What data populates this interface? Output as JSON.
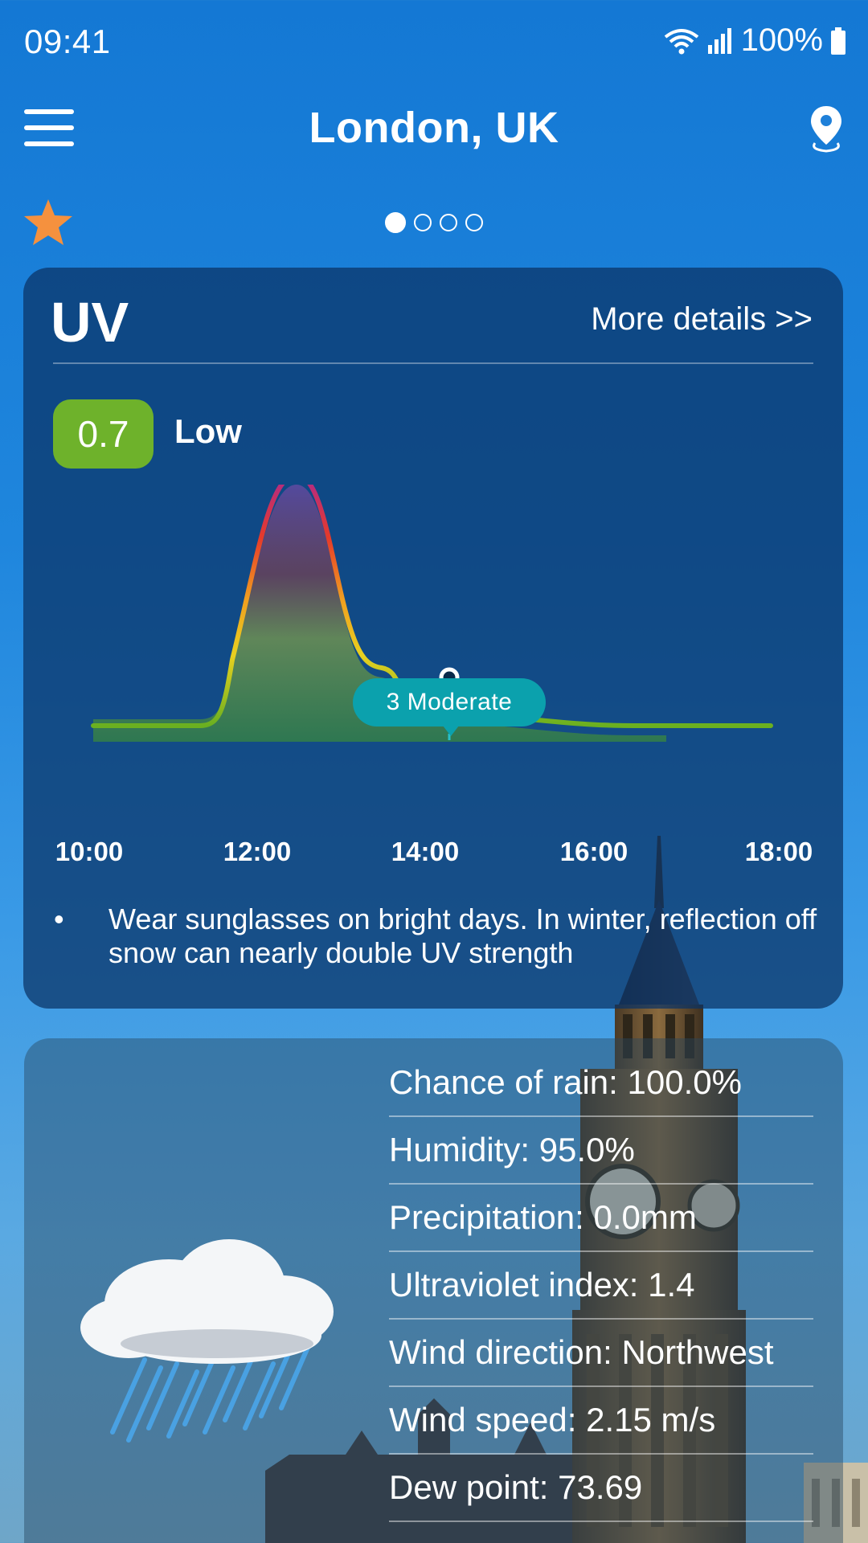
{
  "status": {
    "time": "09:41",
    "battery": "100%"
  },
  "header": {
    "city": "London, UK"
  },
  "pager": {
    "count": 4,
    "active": 0
  },
  "uv_card": {
    "title": "UV",
    "more_details": "More details >>",
    "current_value": "0.7",
    "current_level": "Low",
    "tooltip": "3 Moderate",
    "time_labels": [
      "10:00",
      "12:00",
      "14:00",
      "16:00",
      "18:00"
    ],
    "tips": [
      "Wear sunglasses on bright days. In winter, reflection off snow can nearly double UV strength"
    ],
    "badge_color": "#6eb22b",
    "tooltip_color": "#0ba1ad"
  },
  "weather_card": {
    "icon": "rain-cloud-icon",
    "details": [
      "Chance of rain: 100.0%",
      "Humidity: 95.0%",
      "Precipitation: 0.0mm",
      "Ultraviolet index: 1.4",
      "Wind direction: Northwest",
      "Wind speed: 2.15 m/s",
      "Dew point: 73.69"
    ]
  }
}
